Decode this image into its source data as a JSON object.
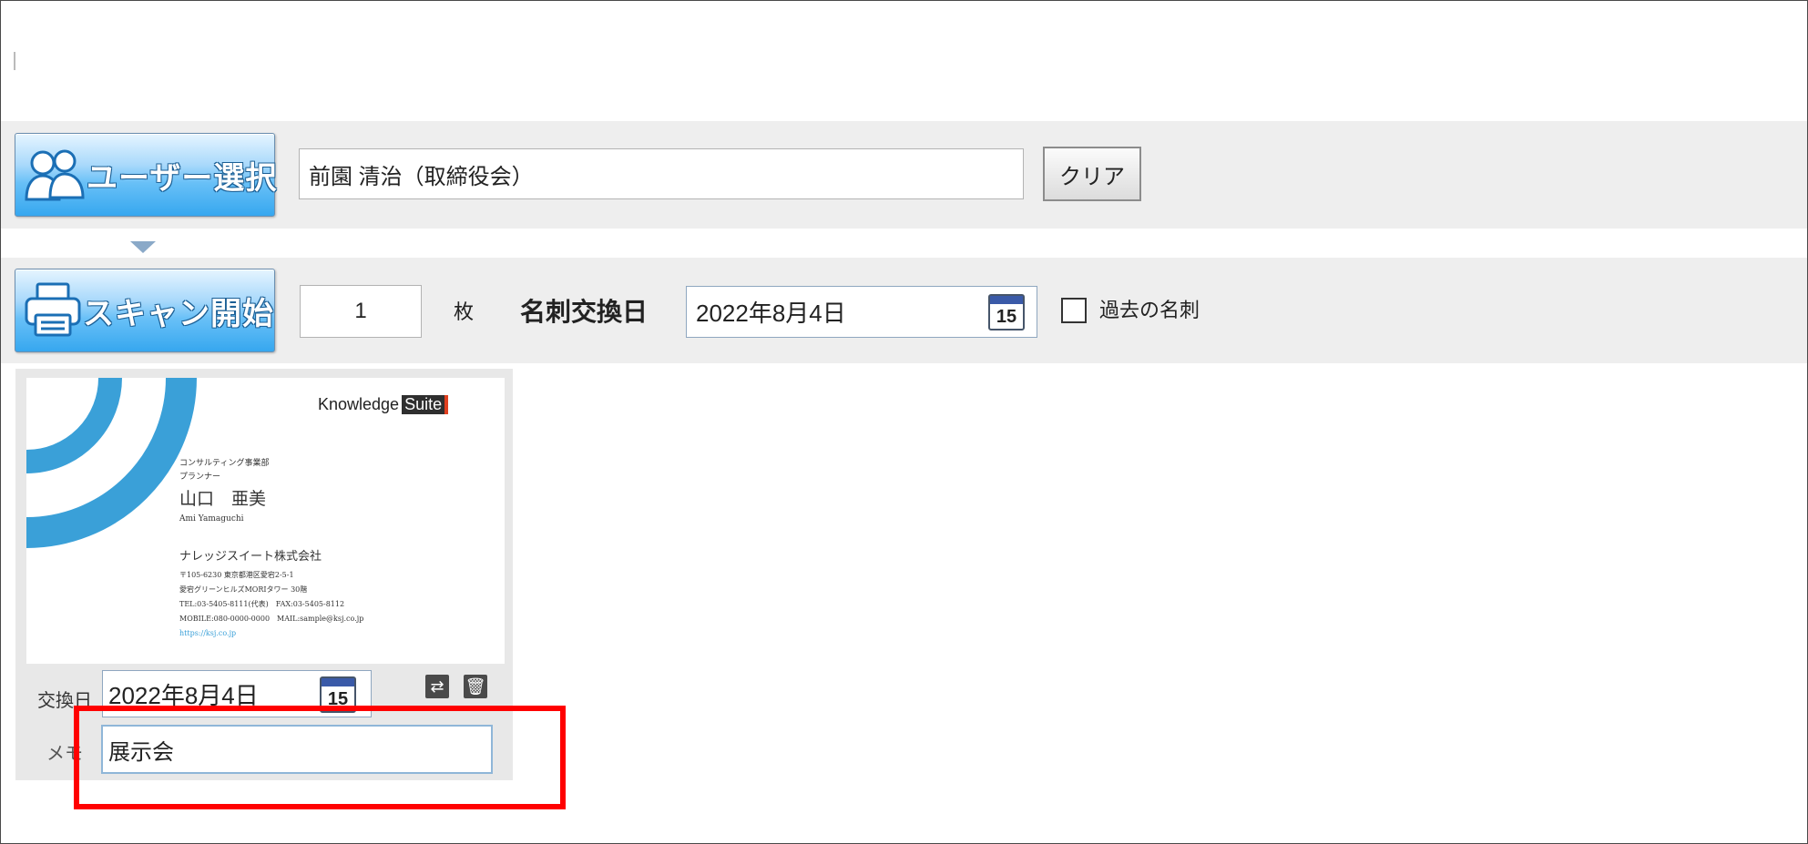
{
  "user_section": {
    "select_button_label": "ユーザー選択",
    "selected_user_value": "前園 清治（取締役会）",
    "clear_button_label": "クリア"
  },
  "scan_section": {
    "scan_button_label": "スキャン開始",
    "count_value": "1",
    "count_unit": "枚",
    "exchange_date_label": "名刺交換日",
    "exchange_date_value": "2022年8月4日",
    "calendar_day": "15",
    "past_cards_label": "過去の名刺",
    "past_cards_checked": false
  },
  "card": {
    "brand_main": "Knowledge",
    "brand_suite": "Suite",
    "department": "コンサルティング事業部",
    "position": "プランナー",
    "name_jp": "山口　亜美",
    "name_en": "Ami Yamaguchi",
    "company": "ナレッジスイート株式会社",
    "address_1": "〒105-6230 東京都港区愛宕2-5-1",
    "address_2": "愛宕グリーンヒルズMORIタワー 30階",
    "phone": "TEL:03-5405-8111(代表)　FAX:03-5405-8112",
    "mobile": "MOBILE:080-0000-0000　MAIL:sample@ksj.co.jp",
    "url": "https://ksj.co.jp",
    "exchange_date_label": "交換日",
    "exchange_date_value": "2022年8月4日",
    "calendar_day": "15",
    "memo_label": "メモ",
    "memo_value": "展示会"
  },
  "colors": {
    "button_blue": "#36a7ef",
    "highlight_red": "#ff0000",
    "card_arc_blue": "#3aa0d8"
  }
}
